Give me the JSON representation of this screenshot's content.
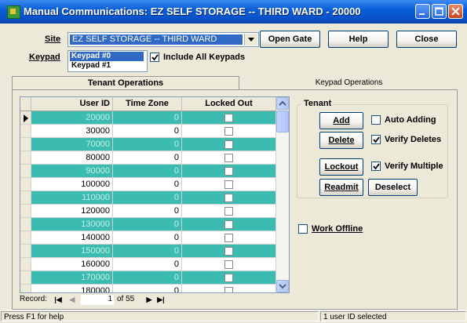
{
  "window": {
    "title": "Manual Communications: EZ SELF STORAGE -- THIRD WARD - 20000"
  },
  "site": {
    "label": "Site",
    "value": "EZ SELF STORAGE -- THIRD WARD"
  },
  "toolbar": {
    "open_gate": "Open Gate",
    "help": "Help",
    "close": "Close"
  },
  "keypad": {
    "label": "Keypad",
    "items": [
      "Keypad #0",
      "Keypad #1"
    ],
    "selected": "Keypad #0",
    "include_all_label": "Include All Keypads",
    "include_all_checked": true
  },
  "tabs": [
    "Tenant Operations",
    "Keypad Operations"
  ],
  "grid": {
    "headers": [
      "User ID",
      "Time Zone",
      "Locked Out"
    ],
    "rows": [
      {
        "user_id": "20000",
        "time_zone": "0",
        "locked_out": false
      },
      {
        "user_id": "30000",
        "time_zone": "0",
        "locked_out": false
      },
      {
        "user_id": "70000",
        "time_zone": "0",
        "locked_out": false
      },
      {
        "user_id": "80000",
        "time_zone": "0",
        "locked_out": false
      },
      {
        "user_id": "90000",
        "time_zone": "0",
        "locked_out": false
      },
      {
        "user_id": "100000",
        "time_zone": "0",
        "locked_out": false
      },
      {
        "user_id": "110000",
        "time_zone": "0",
        "locked_out": false
      },
      {
        "user_id": "120000",
        "time_zone": "0",
        "locked_out": false
      },
      {
        "user_id": "130000",
        "time_zone": "0",
        "locked_out": false
      },
      {
        "user_id": "140000",
        "time_zone": "0",
        "locked_out": false
      },
      {
        "user_id": "150000",
        "time_zone": "0",
        "locked_out": false
      },
      {
        "user_id": "160000",
        "time_zone": "0",
        "locked_out": false
      },
      {
        "user_id": "170000",
        "time_zone": "0",
        "locked_out": false
      },
      {
        "user_id": "180000",
        "time_zone": "0",
        "locked_out": false
      }
    ],
    "alt_row_color": "#3cbcb0"
  },
  "record_nav": {
    "label": "Record:",
    "current": "1",
    "of_text": "of 55"
  },
  "tenant": {
    "group_label": "Tenant",
    "add": "Add",
    "delete": "Delete",
    "lockout": "Lockout",
    "readmit": "Readmit",
    "deselect": "Deselect",
    "auto_adding_label": "Auto Adding",
    "auto_adding_checked": false,
    "verify_deletes_label": "Verify Deletes",
    "verify_deletes_checked": true,
    "verify_multiple_label": "Verify Multiple",
    "verify_multiple_checked": true
  },
  "work_offline": {
    "label": "Work Offline",
    "checked": false
  },
  "status": {
    "left": "Press F1 for help",
    "right": "1 user ID selected"
  }
}
